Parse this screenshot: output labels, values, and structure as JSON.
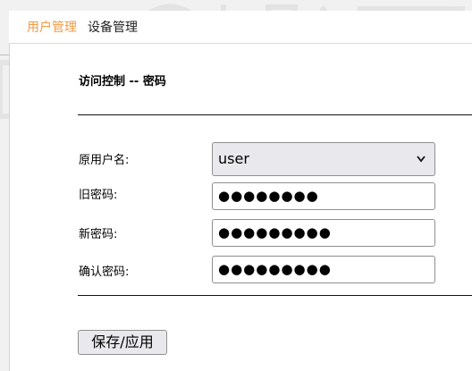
{
  "nav": {
    "tabs": [
      {
        "label": "用户管理",
        "active": true
      },
      {
        "label": "设备管理",
        "active": false
      }
    ]
  },
  "form": {
    "title": "访问控制 -- 密码",
    "fields": {
      "username": {
        "label": "原用户名:",
        "value": "user",
        "type": "select"
      },
      "old_password": {
        "label": "旧密码:",
        "value": "●●●●●●●●"
      },
      "new_password": {
        "label": "新密码:",
        "value": "●●●●●●●●●"
      },
      "confirm_password": {
        "label": "确认密码:",
        "value": "●●●●●●●●●"
      }
    },
    "submit_label": "保存/应用"
  },
  "colors": {
    "active_tab": "#f29a44",
    "background": "#f1f1f1"
  },
  "icons": {
    "select_arrow": "chevron-down-icon"
  }
}
